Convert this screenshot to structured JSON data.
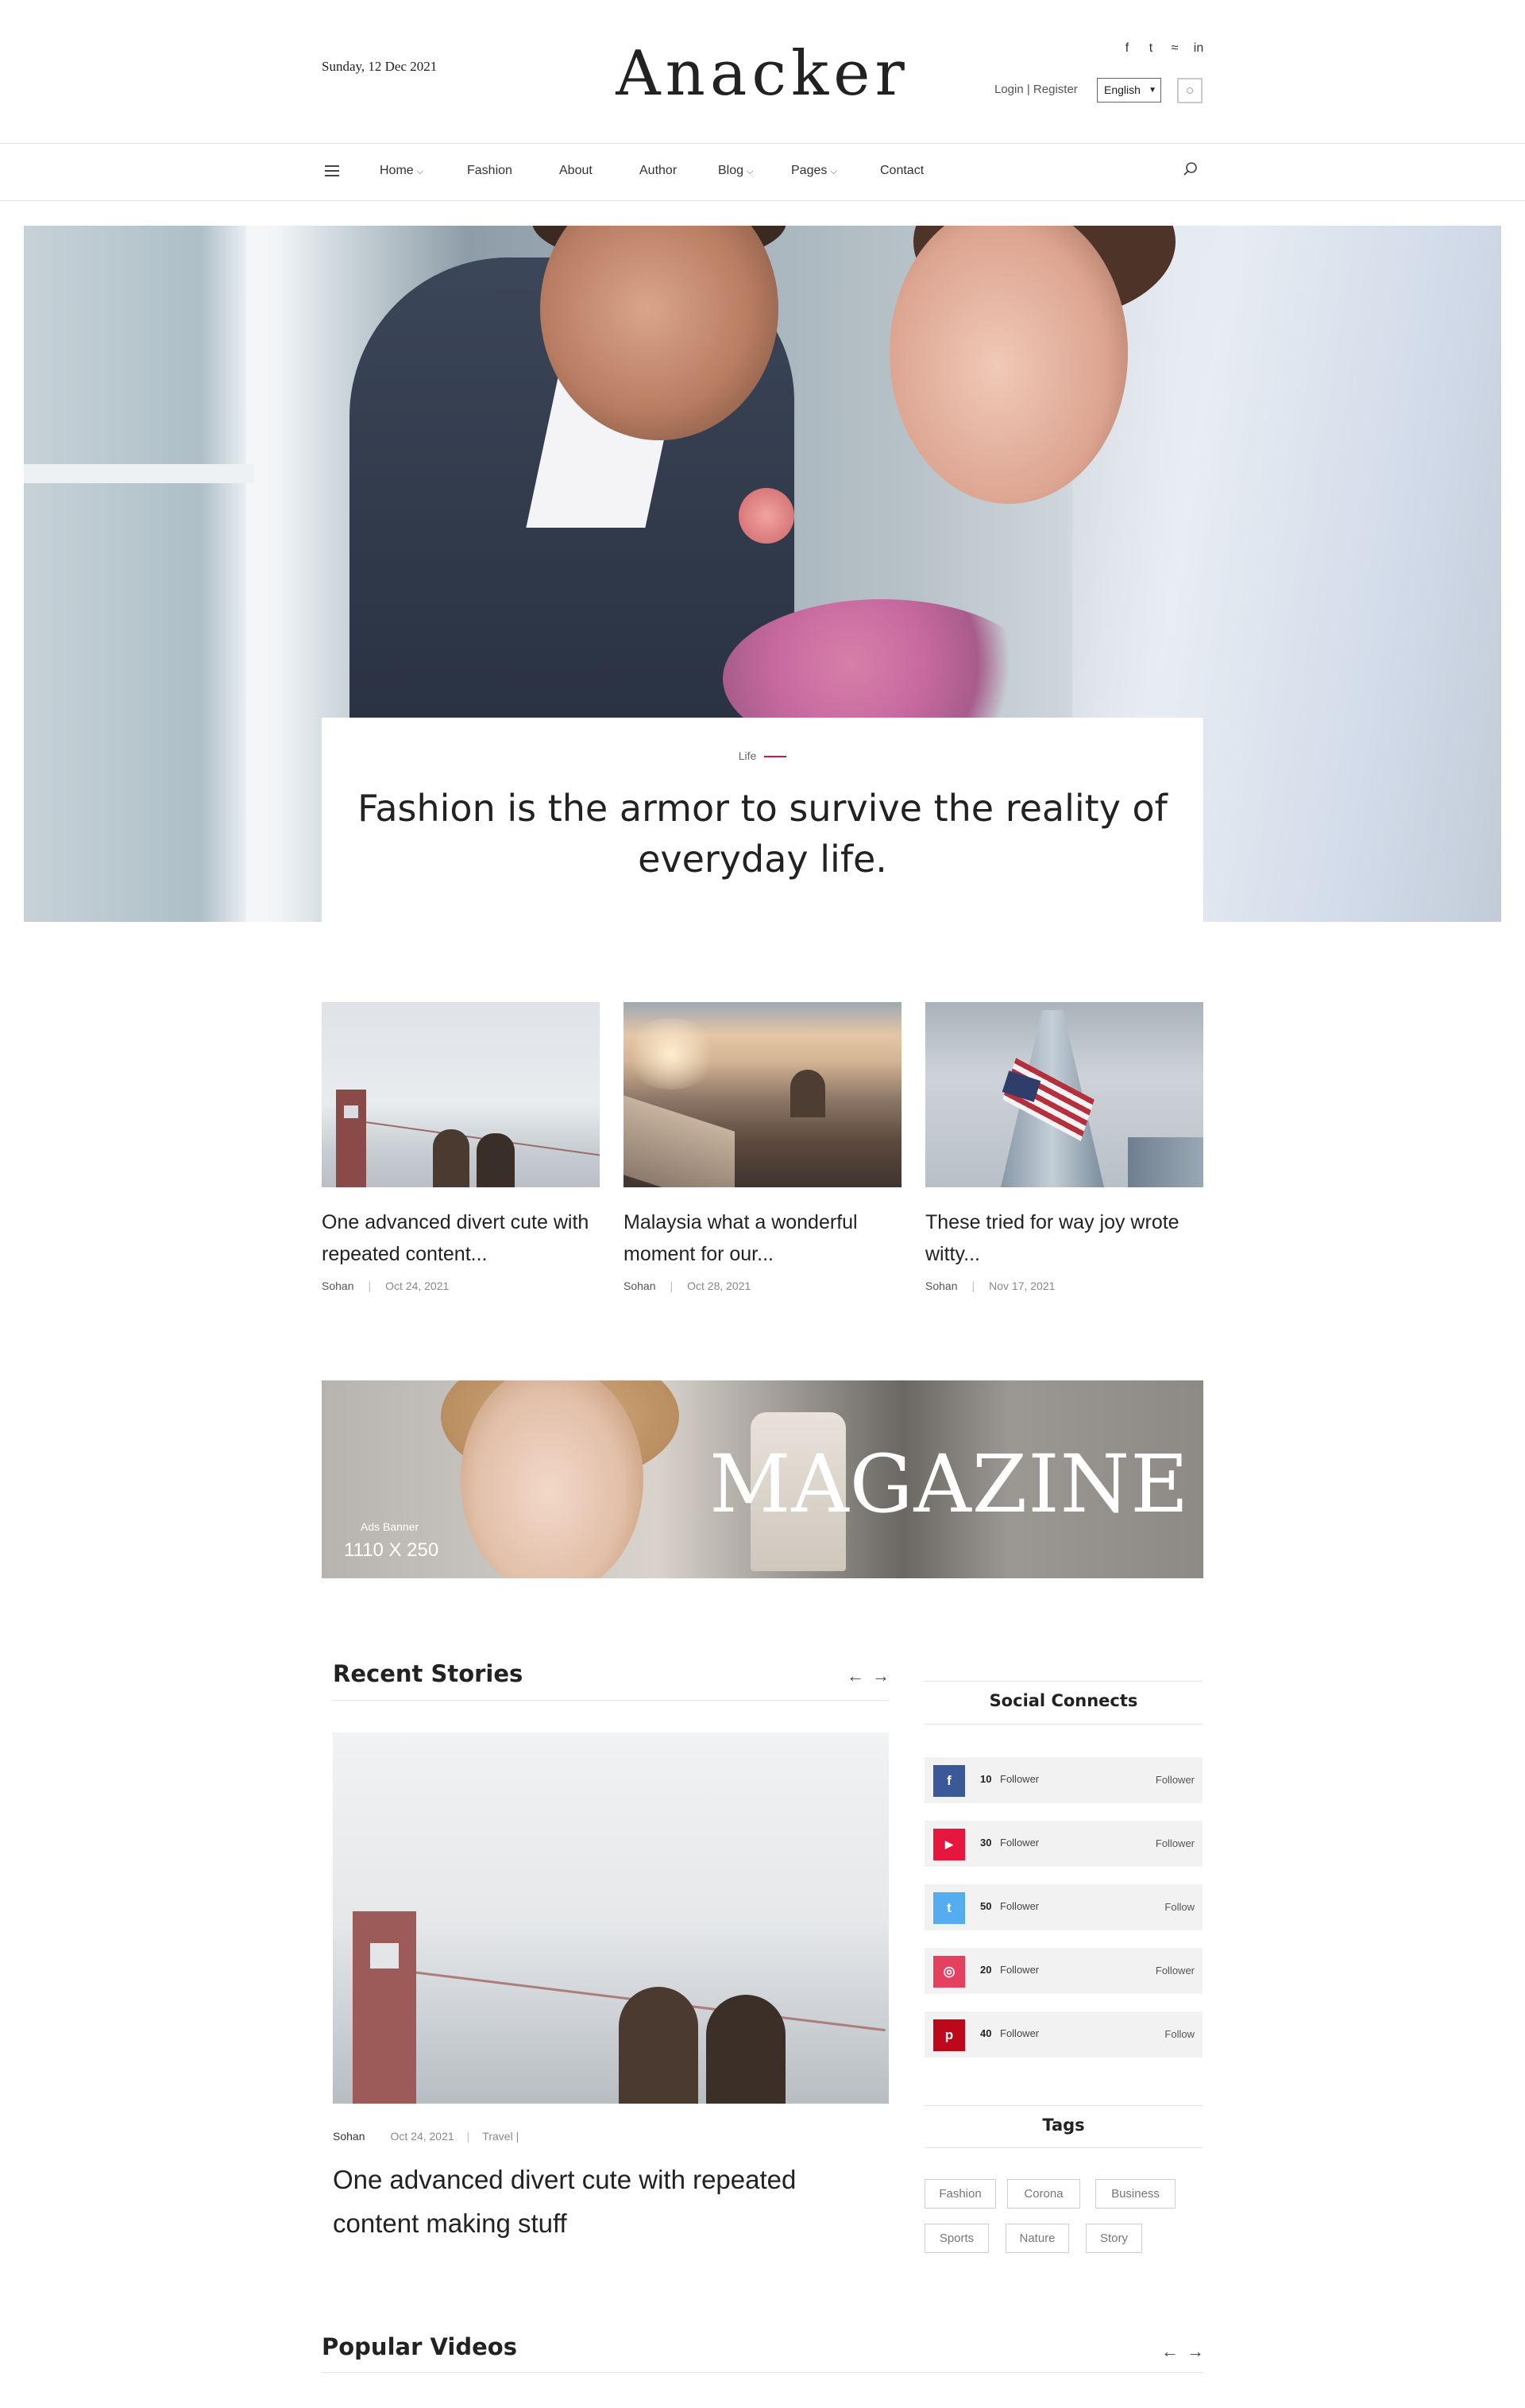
{
  "header": {
    "date": "Sunday, 12 Dec 2021",
    "logo": "Anacker",
    "login_register": "Login | Register",
    "language": "English",
    "social_icons": [
      "facebook-icon",
      "twitter-icon",
      "wifi-icon",
      "linkedin-icon"
    ]
  },
  "nav": {
    "items": [
      {
        "label": "Home",
        "dropdown": true
      },
      {
        "label": "Fashion",
        "dropdown": false
      },
      {
        "label": "About",
        "dropdown": false
      },
      {
        "label": "Author",
        "dropdown": false
      },
      {
        "label": "Blog",
        "dropdown": true
      },
      {
        "label": "Pages",
        "dropdown": true
      },
      {
        "label": "Contact",
        "dropdown": false
      }
    ]
  },
  "hero": {
    "category": "Life",
    "title": "Fashion is the armor to survive the reality of everyday life."
  },
  "cards": [
    {
      "title": "One advanced divert cute with repeated content...",
      "author": "Sohan",
      "date": "Oct 24, 2021"
    },
    {
      "title": "Malaysia what a wonderful moment for our...",
      "author": "Sohan",
      "date": "Oct 28, 2021"
    },
    {
      "title": "These tried for way joy wrote witty...",
      "author": "Sohan",
      "date": "Nov 17, 2021"
    }
  ],
  "ad": {
    "text": "MAGAZINE",
    "label": "Ads Banner",
    "size": "1110 X 250"
  },
  "recent": {
    "title": "Recent Stories",
    "story": {
      "author": "Sohan",
      "date": "Oct 24, 2021",
      "category": "Travel |",
      "title": "One advanced divert cute with repeated content making stuff"
    }
  },
  "sidebar": {
    "social_title": "Social Connects",
    "socials": [
      {
        "icon": "facebook-icon",
        "glyph": "f",
        "color": "#3b5998",
        "count": "10",
        "label": "Follower",
        "action": "Follower"
      },
      {
        "icon": "youtube-icon",
        "glyph": "▶",
        "color": "#e5173f",
        "count": "30",
        "label": "Follower",
        "action": "Follower"
      },
      {
        "icon": "twitter-icon",
        "glyph": "t",
        "color": "#55acee",
        "count": "50",
        "label": "Follower",
        "action": "Follow"
      },
      {
        "icon": "instagram-icon",
        "glyph": "◎",
        "color": "#e4405f",
        "count": "20",
        "label": "Follower",
        "action": "Follower"
      },
      {
        "icon": "pinterest-icon",
        "glyph": "p",
        "color": "#bd081c",
        "count": "40",
        "label": "Follower",
        "action": "Follow"
      }
    ],
    "tags_title": "Tags",
    "tags": [
      "Fashion",
      "Corona",
      "Business",
      "Sports",
      "Nature",
      "Story"
    ]
  },
  "popular": {
    "title": "Popular Videos"
  },
  "colors": {
    "accent": "#c8183e"
  }
}
